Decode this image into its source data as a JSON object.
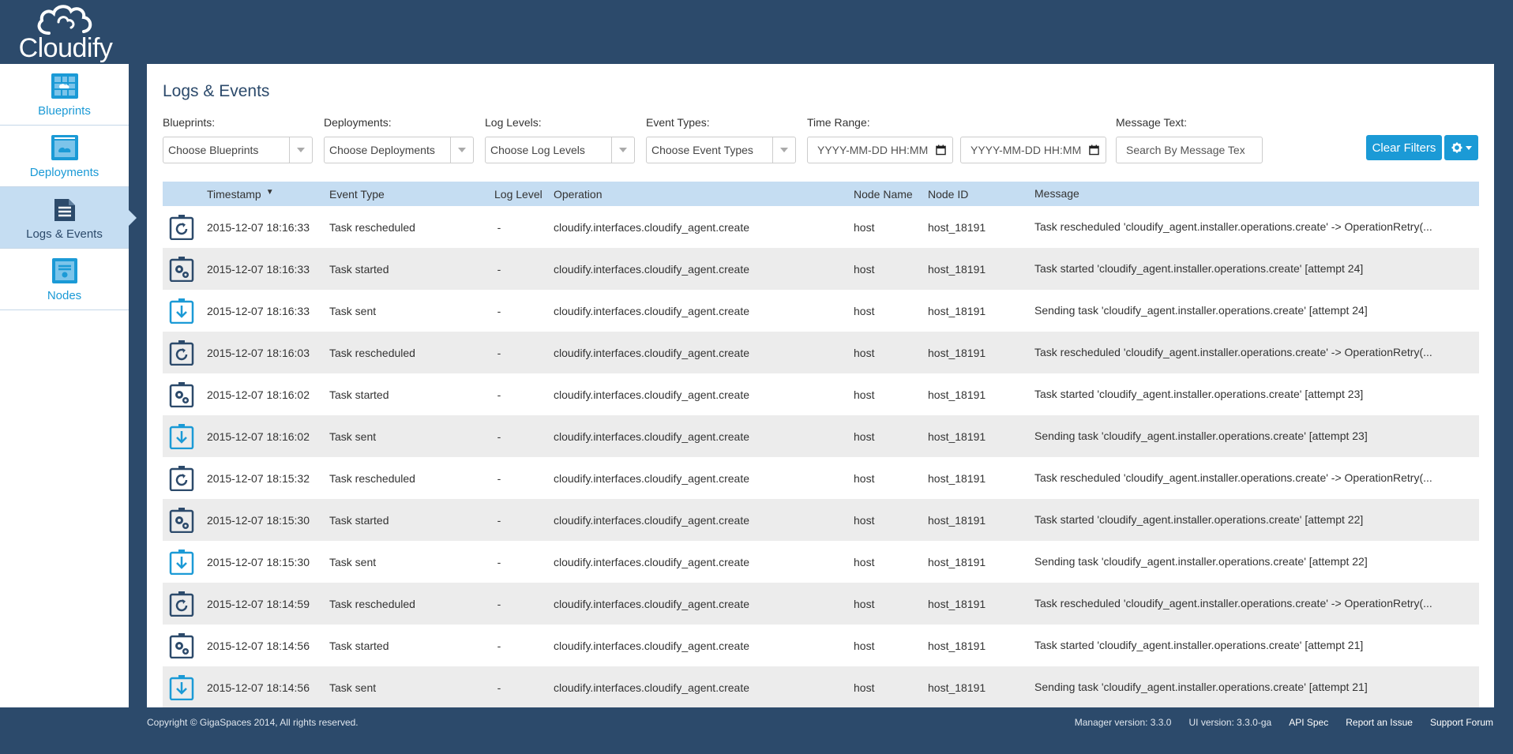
{
  "app": {
    "logo_text": "Cloudify"
  },
  "sidebar": {
    "items": [
      {
        "label": "Blueprints",
        "icon": "blueprints-icon",
        "active": false
      },
      {
        "label": "Deployments",
        "icon": "deployments-icon",
        "active": false
      },
      {
        "label": "Logs & Events",
        "icon": "logs-icon",
        "active": true
      },
      {
        "label": "Nodes",
        "icon": "nodes-icon",
        "active": false
      }
    ]
  },
  "page": {
    "title": "Logs & Events"
  },
  "filters": {
    "blueprints": {
      "label": "Blueprints:",
      "value": "Choose Blueprints"
    },
    "deployments": {
      "label": "Deployments:",
      "value": "Choose Deployments"
    },
    "log_levels": {
      "label": "Log Levels:",
      "value": "Choose Log Levels"
    },
    "event_types": {
      "label": "Event Types:",
      "value": "Choose Event Types"
    },
    "time_range": {
      "label": "Time Range:",
      "from_placeholder": "YYYY-MM-DD HH:MM",
      "to_placeholder": "YYYY-MM-DD HH:MM"
    },
    "message_text": {
      "label": "Message Text:",
      "placeholder": "Search By Message Text"
    },
    "clear_label": "Clear Filters"
  },
  "table": {
    "columns": {
      "timestamp": "Timestamp",
      "event_type": "Event Type",
      "log_level": "Log Level",
      "operation": "Operation",
      "node_name": "Node Name",
      "node_id": "Node ID",
      "message": "Message"
    },
    "rows": [
      {
        "icon": "task-rescheduled-icon",
        "timestamp": "2015-12-07 18:16:33",
        "event_type": "Task rescheduled",
        "log_level": "-",
        "operation": "cloudify.interfaces.cloudify_agent.create",
        "node_name": "host",
        "node_id": "host_18191",
        "message": "Task rescheduled 'cloudify_agent.installer.operations.create' -> OperationRetry(..."
      },
      {
        "icon": "task-started-icon",
        "timestamp": "2015-12-07 18:16:33",
        "event_type": "Task started",
        "log_level": "-",
        "operation": "cloudify.interfaces.cloudify_agent.create",
        "node_name": "host",
        "node_id": "host_18191",
        "message": "Task started 'cloudify_agent.installer.operations.create' [attempt 24]"
      },
      {
        "icon": "task-sent-icon",
        "timestamp": "2015-12-07 18:16:33",
        "event_type": "Task sent",
        "log_level": "-",
        "operation": "cloudify.interfaces.cloudify_agent.create",
        "node_name": "host",
        "node_id": "host_18191",
        "message": "Sending task 'cloudify_agent.installer.operations.create' [attempt 24]"
      },
      {
        "icon": "task-rescheduled-icon",
        "timestamp": "2015-12-07 18:16:03",
        "event_type": "Task rescheduled",
        "log_level": "-",
        "operation": "cloudify.interfaces.cloudify_agent.create",
        "node_name": "host",
        "node_id": "host_18191",
        "message": "Task rescheduled 'cloudify_agent.installer.operations.create' -> OperationRetry(..."
      },
      {
        "icon": "task-started-icon",
        "timestamp": "2015-12-07 18:16:02",
        "event_type": "Task started",
        "log_level": "-",
        "operation": "cloudify.interfaces.cloudify_agent.create",
        "node_name": "host",
        "node_id": "host_18191",
        "message": "Task started 'cloudify_agent.installer.operations.create' [attempt 23]"
      },
      {
        "icon": "task-sent-icon",
        "timestamp": "2015-12-07 18:16:02",
        "event_type": "Task sent",
        "log_level": "-",
        "operation": "cloudify.interfaces.cloudify_agent.create",
        "node_name": "host",
        "node_id": "host_18191",
        "message": "Sending task 'cloudify_agent.installer.operations.create' [attempt 23]"
      },
      {
        "icon": "task-rescheduled-icon",
        "timestamp": "2015-12-07 18:15:32",
        "event_type": "Task rescheduled",
        "log_level": "-",
        "operation": "cloudify.interfaces.cloudify_agent.create",
        "node_name": "host",
        "node_id": "host_18191",
        "message": "Task rescheduled 'cloudify_agent.installer.operations.create' -> OperationRetry(..."
      },
      {
        "icon": "task-started-icon",
        "timestamp": "2015-12-07 18:15:30",
        "event_type": "Task started",
        "log_level": "-",
        "operation": "cloudify.interfaces.cloudify_agent.create",
        "node_name": "host",
        "node_id": "host_18191",
        "message": "Task started 'cloudify_agent.installer.operations.create' [attempt 22]"
      },
      {
        "icon": "task-sent-icon",
        "timestamp": "2015-12-07 18:15:30",
        "event_type": "Task sent",
        "log_level": "-",
        "operation": "cloudify.interfaces.cloudify_agent.create",
        "node_name": "host",
        "node_id": "host_18191",
        "message": "Sending task 'cloudify_agent.installer.operations.create' [attempt 22]"
      },
      {
        "icon": "task-rescheduled-icon",
        "timestamp": "2015-12-07 18:14:59",
        "event_type": "Task rescheduled",
        "log_level": "-",
        "operation": "cloudify.interfaces.cloudify_agent.create",
        "node_name": "host",
        "node_id": "host_18191",
        "message": "Task rescheduled 'cloudify_agent.installer.operations.create' -> OperationRetry(..."
      },
      {
        "icon": "task-started-icon",
        "timestamp": "2015-12-07 18:14:56",
        "event_type": "Task started",
        "log_level": "-",
        "operation": "cloudify.interfaces.cloudify_agent.create",
        "node_name": "host",
        "node_id": "host_18191",
        "message": "Task started 'cloudify_agent.installer.operations.create' [attempt 21]"
      },
      {
        "icon": "task-sent-icon",
        "timestamp": "2015-12-07 18:14:56",
        "event_type": "Task sent",
        "log_level": "-",
        "operation": "cloudify.interfaces.cloudify_agent.create",
        "node_name": "host",
        "node_id": "host_18191",
        "message": "Sending task 'cloudify_agent.installer.operations.create' [attempt 21]"
      }
    ]
  },
  "footer": {
    "copyright": "Copyright © GigaSpaces 2014, All rights reserved.",
    "manager_version": "Manager version: 3.3.0",
    "ui_version": "UI version: 3.3.0-ga",
    "links": [
      "API Spec",
      "Report an Issue",
      "Support Forum"
    ]
  },
  "colors": {
    "header": "#2c4a6b",
    "accent": "#1b9ad6",
    "table_header": "#c5ddf2",
    "row_alt": "#ececec"
  }
}
